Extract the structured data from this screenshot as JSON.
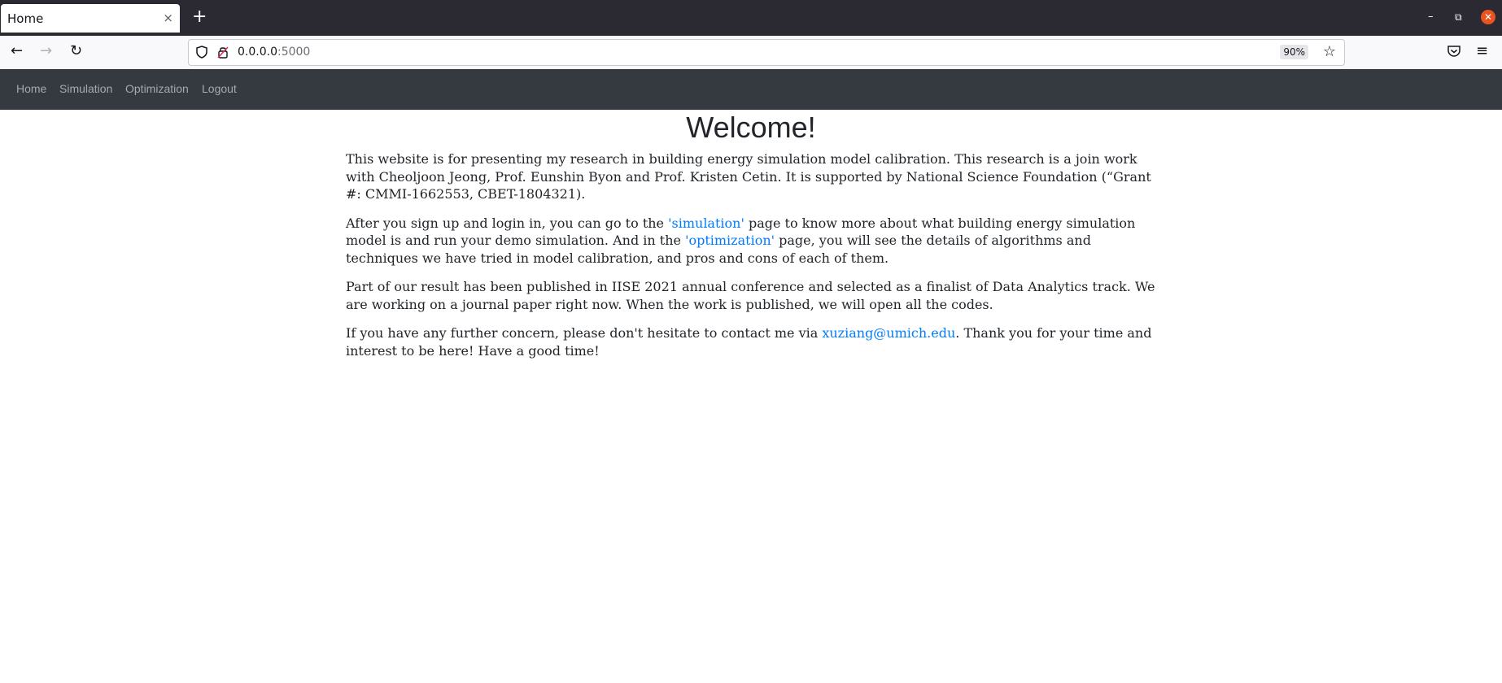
{
  "browser": {
    "tab_title": "Home",
    "tab_close": "×",
    "new_tab": "+",
    "url_host": "0.0.0.0",
    "url_port": ":5000",
    "zoom": "90%"
  },
  "navbar": {
    "items": [
      {
        "label": "Home"
      },
      {
        "label": "Simulation"
      },
      {
        "label": "Optimization"
      },
      {
        "label": "Logout"
      }
    ]
  },
  "main": {
    "title": "Welcome!",
    "p1": "This website is for presenting my research in building energy simulation model calibration. This research is a join work with Cheoljoon Jeong, Prof. Eunshin Byon and Prof. Kristen Cetin. It is supported by National Science Foundation (“Grant #: CMMI-1662553, CBET-1804321).",
    "p2_pre": "After you sign up and login in, you can go to the ",
    "p2_link1": "'simulation'",
    "p2_mid": " page to know more about what building energy simulation model is and run your demo simulation. And in the ",
    "p2_link2": "'optimization'",
    "p2_post": " page, you will see the details of algorithms and techniques we have tried in model calibration, and pros and cons of each of them.",
    "p3": "Part of our result has been published in IISE 2021 annual conference and selected as a finalist of Data Analytics track. We are working on a journal paper right now. When the work is published, we will open all the codes.",
    "p4_pre": "If you have any further concern, please don't hesitate to contact me via ",
    "p4_email": "xuziang@umich.edu",
    "p4_post": ". Thank you for your time and interest to be here! Have a good time!"
  },
  "colors": {
    "navbar_bg": "#343a40",
    "link": "#007bff",
    "tab_strip": "#2b2a33"
  }
}
